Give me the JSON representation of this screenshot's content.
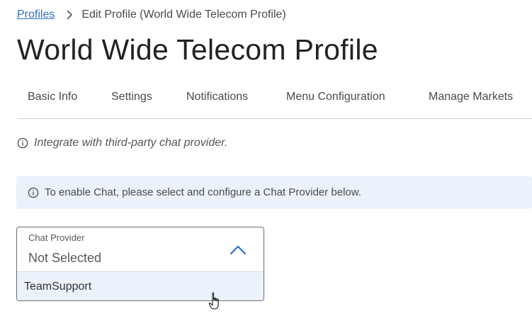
{
  "breadcrumb": {
    "root_link": "Profiles",
    "current": "Edit Profile (World Wide Telecom Profile)"
  },
  "page": {
    "title": "World Wide Telecom Profile"
  },
  "tabs": [
    {
      "label": "Basic Info"
    },
    {
      "label": "Settings"
    },
    {
      "label": "Notifications"
    },
    {
      "label": "Menu Configuration"
    },
    {
      "label": "Manage Markets"
    }
  ],
  "hint": {
    "icon": "info-circle-icon",
    "text": "Integrate with third-party chat provider."
  },
  "alert": {
    "icon": "info-circle-icon",
    "text": "To enable Chat, please select and configure a Chat Provider below.",
    "background": "#ecf2fb"
  },
  "chat_provider": {
    "label": "Chat Provider",
    "value": "Not Selected",
    "expanded": true,
    "options": [
      {
        "label": "TeamSupport",
        "highlighted": true
      }
    ]
  },
  "colors": {
    "link": "#2a6fc9",
    "chevron": "#2a6fc9",
    "option_highlight": "#ecf2fb"
  }
}
